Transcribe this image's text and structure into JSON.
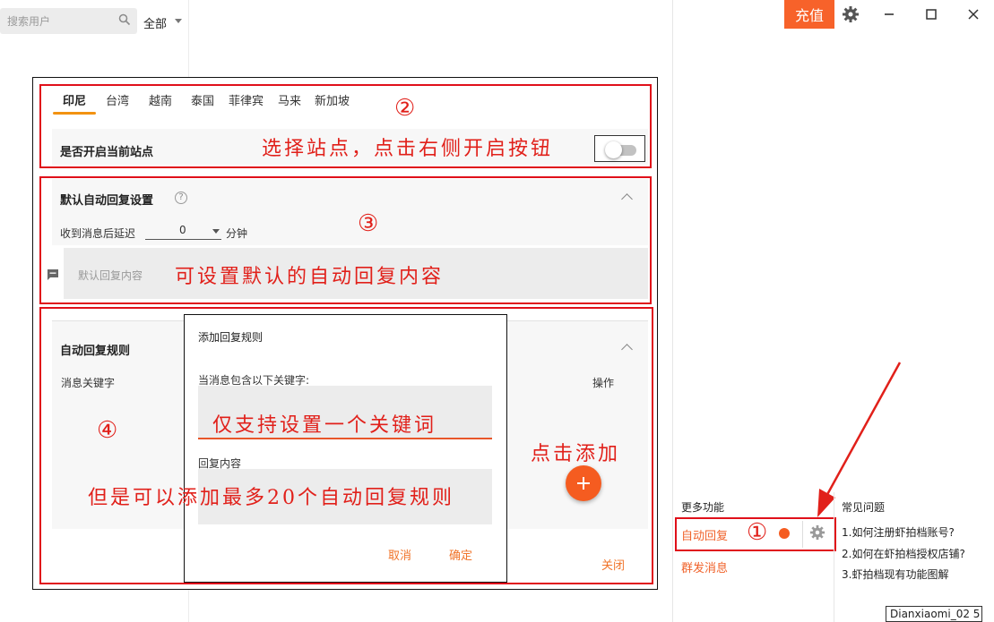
{
  "search": {
    "placeholder": "搜索用户"
  },
  "filter": {
    "selected": "全部"
  },
  "header": {
    "recharge_label": "充值"
  },
  "site_section": {
    "tabs": [
      "印尼",
      "台湾",
      "越南",
      "泰国",
      "菲律宾",
      "马来",
      "新加坡"
    ],
    "active_tab": "印尼",
    "enable_label": "是否开启当前站点",
    "enabled": false
  },
  "default_reply": {
    "title": "默认自动回复设置",
    "delay_label": "收到消息后延迟",
    "delay_value": "0",
    "delay_unit": "分钟",
    "content_placeholder": "默认回复内容"
  },
  "rules": {
    "title": "自动回复规则",
    "col_keyword": "消息关键字",
    "col_action": "操作",
    "close_label": "关闭"
  },
  "dialog": {
    "title": "添加回复规则",
    "keyword_label": "当消息包含以下关键字:",
    "reply_label": "回复内容",
    "cancel_label": "取消",
    "confirm_label": "确定"
  },
  "annotations": {
    "n1": "①",
    "n2": "②",
    "n3": "③",
    "n4": "④",
    "site_tip": "选择站点，点击右侧开启按钮",
    "default_tip": "可设置默认的自动回复内容",
    "keyword_tip": "仅支持设置一个关键词",
    "rules_tip": "但是可以添加最多20个自动回复规则",
    "add_tip": "点击添加"
  },
  "more": {
    "title": "更多功能",
    "auto_reply": "自动回复",
    "mass_message": "群发消息"
  },
  "faq": {
    "title": "常见问题",
    "items": [
      "1.如何注册虾拍档账号?",
      "2.如何在虾拍档授权店铺?",
      "3.虾拍档现有功能图解"
    ]
  },
  "footer": {
    "version": "Dianxiaomi_02 5"
  },
  "colors": {
    "accent": "#f7622a",
    "annotation": "#e0101a",
    "tab_underline": "#f29211"
  }
}
